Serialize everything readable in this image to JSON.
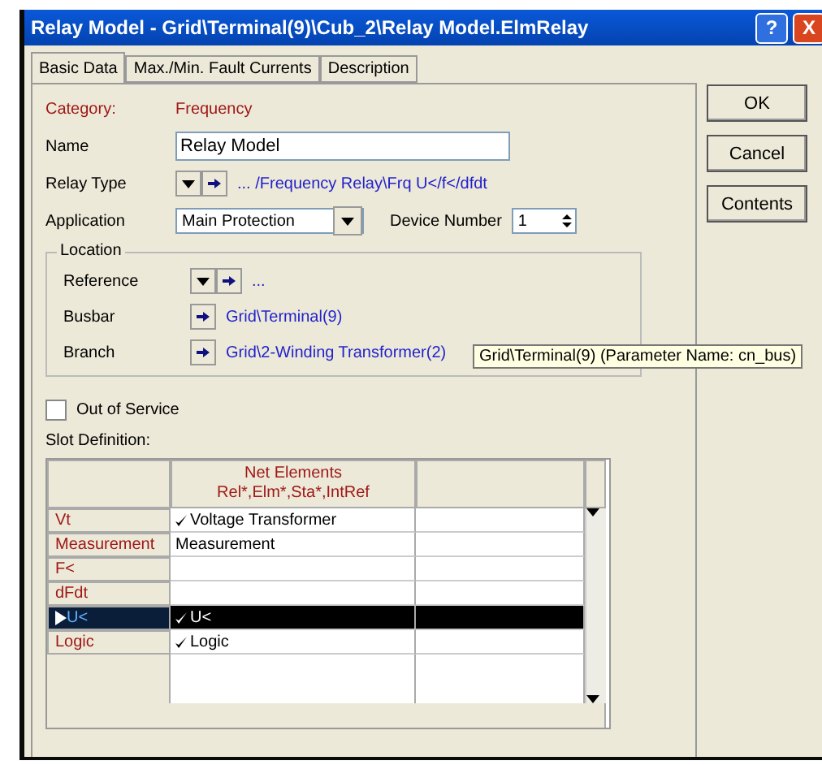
{
  "window": {
    "title": "Relay Model - Grid\\Terminal(9)\\Cub_2\\Relay Model.ElmRelay",
    "help": "?",
    "close": "X"
  },
  "tabs": [
    {
      "label": "Basic Data",
      "selected": true
    },
    {
      "label": "Max./Min. Fault Currents",
      "selected": false
    },
    {
      "label": "Description",
      "selected": false
    }
  ],
  "category": {
    "label": "Category:",
    "value": "Frequency"
  },
  "name": {
    "label": "Name",
    "value": "Relay Model"
  },
  "relay_type": {
    "label": "Relay Type",
    "value": "... /Frequency Relay\\Frq U</f</dfdt"
  },
  "application": {
    "label": "Application",
    "value": "Main Protection"
  },
  "device_number": {
    "label": "Device Number",
    "value": "1"
  },
  "location": {
    "title": "Location",
    "rows": [
      {
        "label": "Reference",
        "kind": "select",
        "value": "..."
      },
      {
        "label": "Busbar",
        "kind": "link",
        "value": "Grid\\Terminal(9)"
      },
      {
        "label": "Branch",
        "kind": "link",
        "value": "Grid\\2-Winding Transformer(2)"
      }
    ]
  },
  "tooltip": "Grid\\Terminal(9)  (Parameter Name: cn_bus)",
  "out_of_service": {
    "label": "Out of Service",
    "checked": false
  },
  "slot_definition": {
    "title": "Slot Definition:",
    "header_line_1": "Net Elements",
    "header_line_2": "Rel*,Elm*,Sta*,IntRef",
    "rows": [
      {
        "slot": "Vt",
        "value": "Voltage Transformer",
        "checked": true,
        "selected": false
      },
      {
        "slot": "Measurement",
        "value": "Measurement",
        "checked": false,
        "selected": false
      },
      {
        "slot": "F<",
        "value": "",
        "checked": false,
        "selected": false
      },
      {
        "slot": "dFdt",
        "value": "",
        "checked": false,
        "selected": false
      },
      {
        "slot": "U<",
        "value": "U<",
        "checked": true,
        "selected": true
      },
      {
        "slot": "Logic",
        "value": "Logic",
        "checked": true,
        "selected": false
      }
    ]
  },
  "buttons": [
    "OK",
    "Cancel",
    "Contents"
  ]
}
